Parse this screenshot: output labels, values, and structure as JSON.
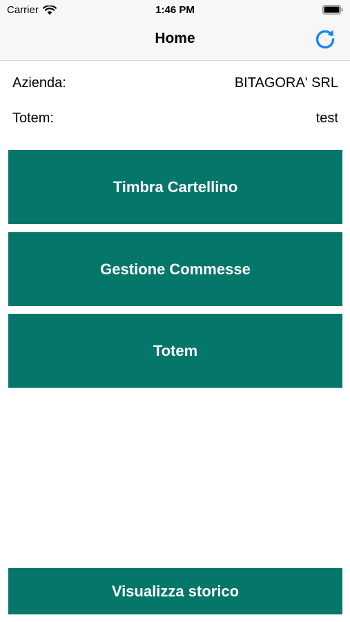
{
  "status_bar": {
    "carrier": "Carrier",
    "time": "1:46 PM",
    "wifi_icon": "wifi-icon",
    "battery_icon": "battery-icon"
  },
  "nav": {
    "title": "Home",
    "refresh_icon": "refresh-icon",
    "accent_color": "#1a82fb"
  },
  "info": {
    "company_label": "Azienda:",
    "company_value": "BITAGORA' SRL",
    "totem_label": "Totem:",
    "totem_value": "test"
  },
  "actions": {
    "timbra_label": "Timbra Cartellino",
    "gestione_label": "Gestione Commesse",
    "totem_label": "Totem",
    "storico_label": "Visualizza storico"
  },
  "colors": {
    "button_bg": "#04766a",
    "nav_bg": "#f7f7f7"
  }
}
